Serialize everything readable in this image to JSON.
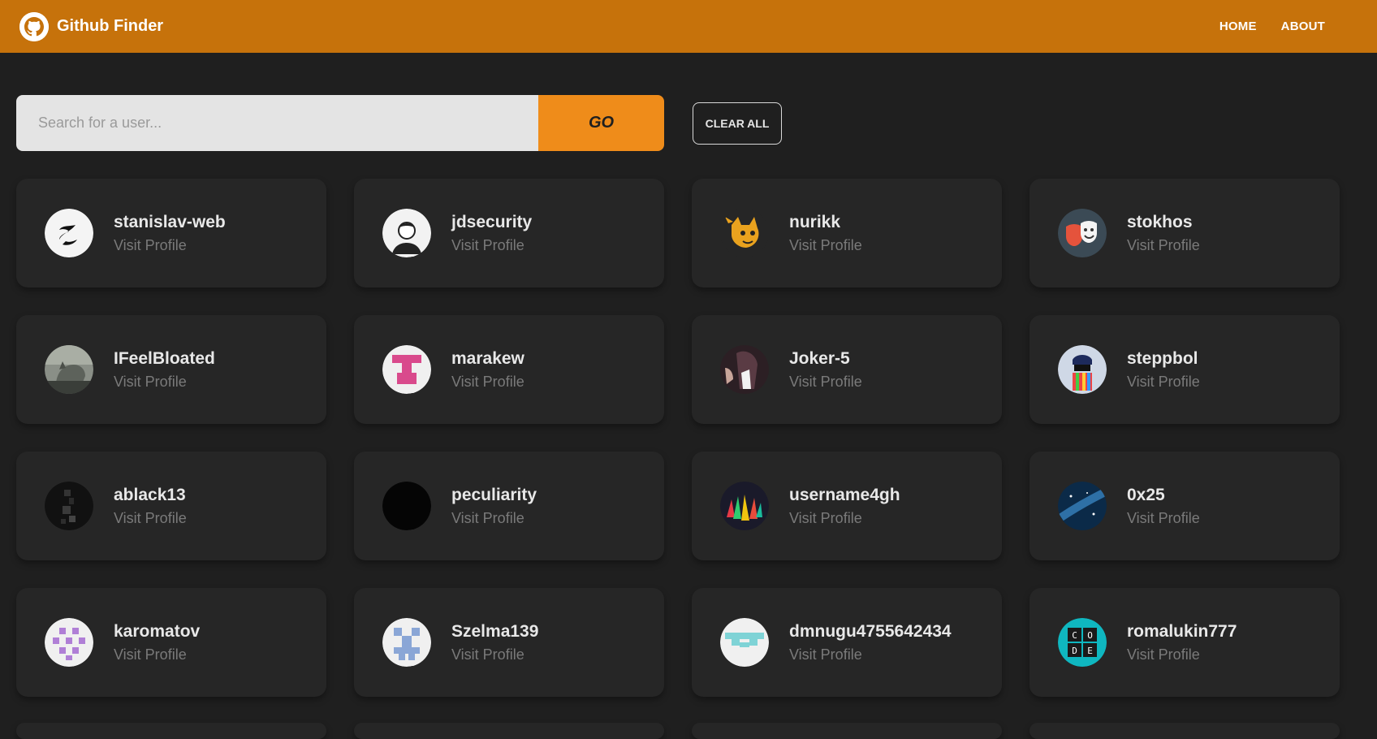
{
  "navbar": {
    "title": "Github Finder",
    "logo_icon": "github-icon",
    "links": [
      "HOME",
      "ABOUT"
    ],
    "background": "#c6720b"
  },
  "search": {
    "placeholder": "Search for a user...",
    "value": "",
    "go_label": "GO",
    "clear_label": "CLEAR ALL"
  },
  "users": [
    {
      "login": "stanislav-web",
      "link_label": "Visit Profile",
      "avatar_icon": "dragon-avatar"
    },
    {
      "login": "jdsecurity",
      "link_label": "Visit Profile",
      "avatar_icon": "person-avatar"
    },
    {
      "login": "nurikk",
      "link_label": "Visit Profile",
      "avatar_icon": "cat-avatar"
    },
    {
      "login": "stokhos",
      "link_label": "Visit Profile",
      "avatar_icon": "theater-masks-avatar"
    },
    {
      "login": "IFeelBloated",
      "link_label": "Visit Profile",
      "avatar_icon": "cat-photo-avatar"
    },
    {
      "login": "marakew",
      "link_label": "Visit Profile",
      "avatar_icon": "identicon-pink-avatar"
    },
    {
      "login": "Joker-5",
      "link_label": "Visit Profile",
      "avatar_icon": "photo-avatar"
    },
    {
      "login": "steppbol",
      "link_label": "Visit Profile",
      "avatar_icon": "colorful-figure-avatar"
    },
    {
      "login": "ablack13",
      "link_label": "Visit Profile",
      "avatar_icon": "dark-photo-avatar"
    },
    {
      "login": "peculiarity",
      "link_label": "Visit Profile",
      "avatar_icon": "black-avatar"
    },
    {
      "login": "username4gh",
      "link_label": "Visit Profile",
      "avatar_icon": "crystals-avatar"
    },
    {
      "login": "0x25",
      "link_label": "Visit Profile",
      "avatar_icon": "galaxy-avatar"
    },
    {
      "login": "karomatov",
      "link_label": "Visit Profile",
      "avatar_icon": "identicon-purple-avatar"
    },
    {
      "login": "Szelma139",
      "link_label": "Visit Profile",
      "avatar_icon": "identicon-blue-avatar"
    },
    {
      "login": "dmnugu4755642434",
      "link_label": "Visit Profile",
      "avatar_icon": "identicon-teal-avatar"
    },
    {
      "login": "romalukin777",
      "link_label": "Visit Profile",
      "avatar_icon": "code-avatar"
    }
  ],
  "code_avatar_letters": [
    "C",
    "O",
    "D",
    "E"
  ],
  "colors": {
    "accent": "#ef8c1a",
    "background": "#1f1f1f",
    "card": "#262626"
  }
}
